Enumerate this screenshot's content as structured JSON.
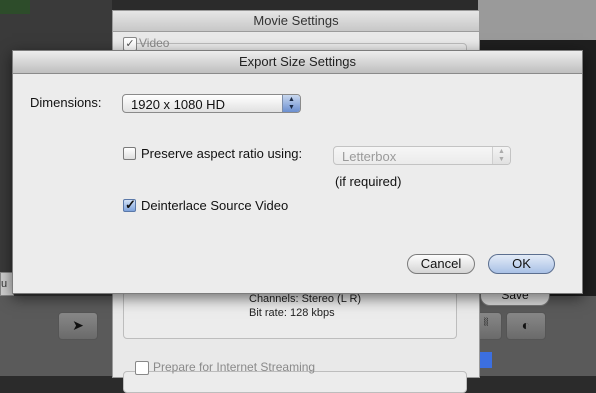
{
  "background": {
    "movie_settings": {
      "title": "Movie Settings",
      "video_label": "Video",
      "audio_info": [
        "Channels: Stereo (L R)",
        "Bit rate: 128 kbps"
      ],
      "streaming_label": "Prepare for Internet Streaming"
    },
    "save_button": "Save",
    "partial_left_char": "u"
  },
  "dialog": {
    "title": "Export Size Settings",
    "dimensions_label": "Dimensions:",
    "dimensions_value": "1920 x 1080 HD",
    "preserve_label": "Preserve aspect ratio using:",
    "preserve_checked": false,
    "preserve_value": "Letterbox",
    "if_required": "(if required)",
    "deinterlace_label": "Deinterlace Source Video",
    "deinterlace_checked": true,
    "cancel_label": "Cancel",
    "ok_label": "OK"
  },
  "icons": {
    "pointer": "arrow-pointer-icon",
    "waveform": "waveform-icon",
    "color": "color-wheel-icon"
  }
}
